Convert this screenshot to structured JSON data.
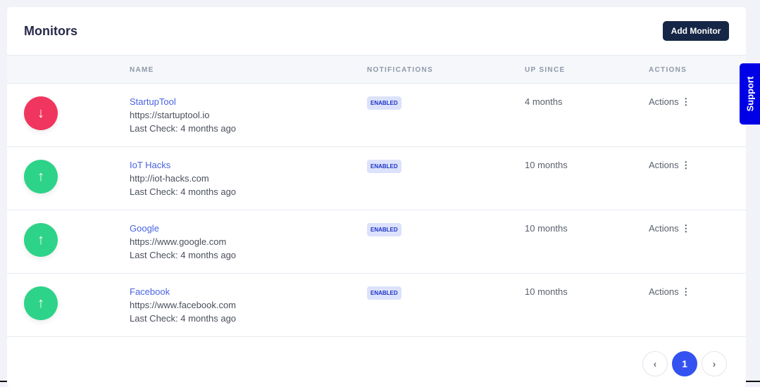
{
  "header": {
    "title": "Monitors",
    "add_button": "Add Monitor"
  },
  "columns": {
    "name": "NAME",
    "notifications": "NOTIFICATIONS",
    "up_since": "UP SINCE",
    "actions": "ACTIONS"
  },
  "monitors": [
    {
      "status": "down",
      "name": "StartupTool",
      "url": "https://startuptool.io",
      "last_check": "Last Check: 4 months ago",
      "notifications": "ENABLED",
      "up_since": "4 months",
      "actions": "Actions"
    },
    {
      "status": "up",
      "name": "IoT Hacks",
      "url": "http://iot-hacks.com",
      "last_check": "Last Check: 4 months ago",
      "notifications": "ENABLED",
      "up_since": "10 months",
      "actions": "Actions"
    },
    {
      "status": "up",
      "name": "Google",
      "url": "https://www.google.com",
      "last_check": "Last Check: 4 months ago",
      "notifications": "ENABLED",
      "up_since": "10 months",
      "actions": "Actions"
    },
    {
      "status": "up",
      "name": "Facebook",
      "url": "https://www.facebook.com",
      "last_check": "Last Check: 4 months ago",
      "notifications": "ENABLED",
      "up_since": "10 months",
      "actions": "Actions"
    }
  ],
  "pagination": {
    "current": "1"
  },
  "support": "Support",
  "colors": {
    "down": "#f0365e",
    "up": "#2ed38a",
    "accent": "#3452f0"
  }
}
